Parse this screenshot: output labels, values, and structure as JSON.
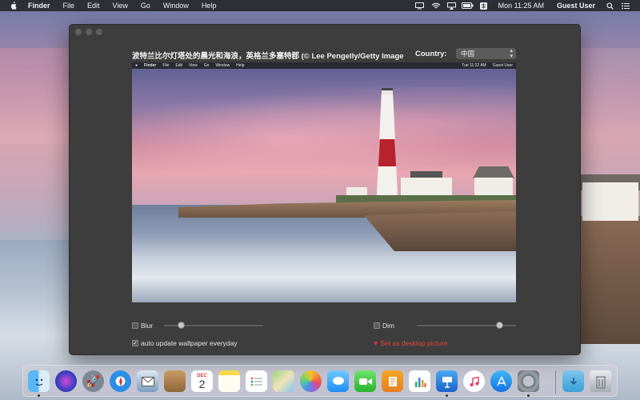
{
  "menubar": {
    "app_name": "Finder",
    "menus": [
      "File",
      "Edit",
      "View",
      "Go",
      "Window",
      "Help"
    ],
    "clock": "Mon 11:25 AM",
    "user": "Guest User"
  },
  "window": {
    "title": "波特兰比尔灯塔处的晨光和海浪，英格兰多塞特郡 (© Lee Pengelly/Getty Image",
    "country_label": "Country:",
    "country_value": "中国",
    "preview_menubar": {
      "app_name": "Finder",
      "menus": [
        "File",
        "Edit",
        "View",
        "Go",
        "Window",
        "Help"
      ],
      "clock": "Tue 11:22 AM",
      "user": "Guest User"
    },
    "blur": {
      "label": "Blur",
      "checked": false,
      "value": 0.15
    },
    "dim": {
      "label": "Dim",
      "checked": false,
      "value": 0.85
    },
    "auto_update": {
      "label": "auto update wallpaper everyday",
      "checked": true
    },
    "set_desktop_label": "Set as desktop picture"
  },
  "dock": {
    "apps": [
      "Finder",
      "Siri",
      "Launchpad",
      "Safari",
      "Mail",
      "Contacts",
      "Calendar",
      "Notes",
      "Reminders",
      "Maps",
      "Photos",
      "Messages",
      "FaceTime",
      "Pages",
      "Numbers",
      "Keynote",
      "iTunes",
      "App Store",
      "System Preferences"
    ],
    "calendar_month": "DEC",
    "calendar_day": "2",
    "right": [
      "Downloads",
      "Trash"
    ]
  }
}
